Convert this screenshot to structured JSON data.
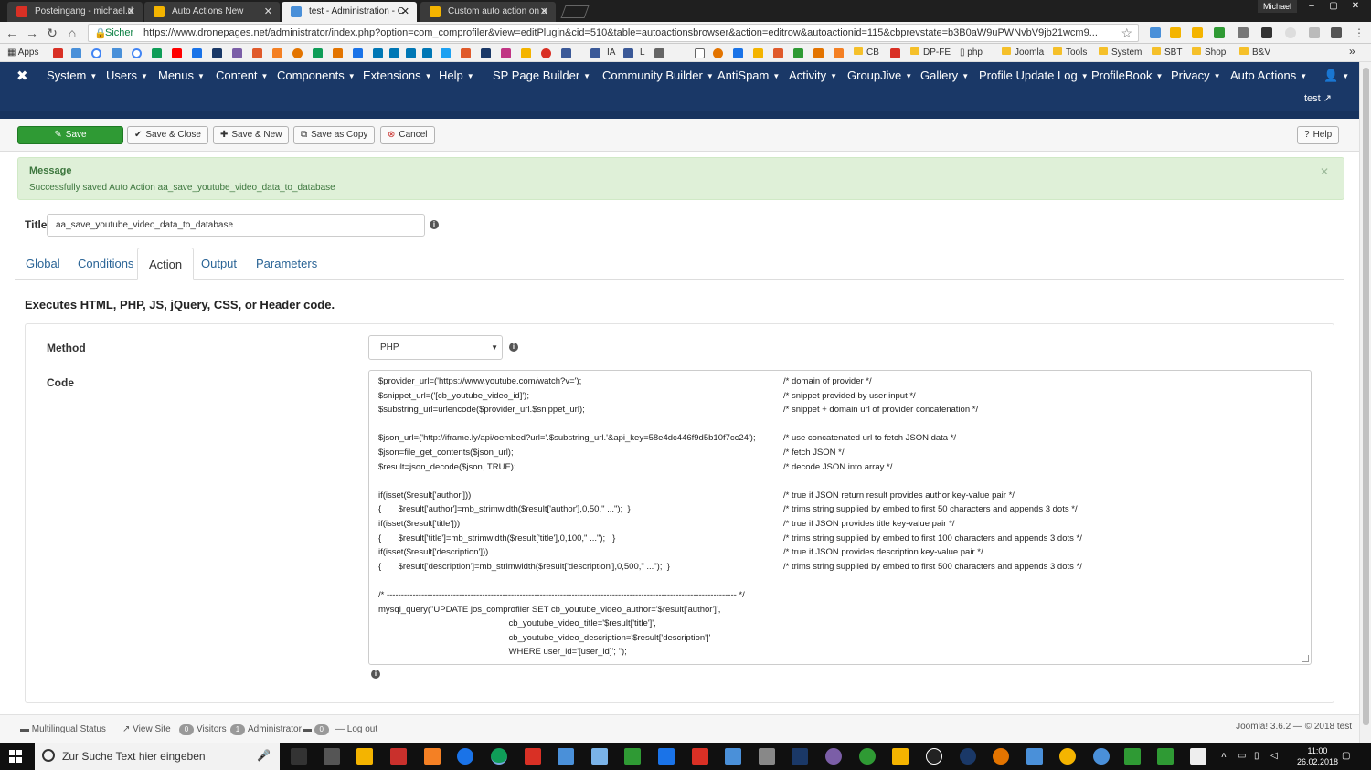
{
  "browser": {
    "tabs": [
      {
        "title": "Posteingang - michael.d",
        "favicon_color": "#d93025"
      },
      {
        "title": "Auto Actions New",
        "favicon_color": "#f4b400"
      },
      {
        "title": "test - Administration - C",
        "favicon_color": "#4a90d9"
      },
      {
        "title": "Custom auto action on a",
        "favicon_color": "#f4b400"
      }
    ],
    "profile": "Michael",
    "secure_label": "Sicher",
    "url": "https://www.dronepages.net/administrator/index.php?option=com_comprofiler&view=editPlugin&cid=510&table=autoactionsbrowser&action=editrow&autoactionid=115&cbprevstate=b3B0aW9uPWNvbV9jb21wcm9..."
  },
  "bookmarks": {
    "apps_label": "Apps",
    "items": [
      "IA",
      "L",
      "CB",
      "DP-FE",
      "php",
      "Joomla",
      "Tools",
      "System",
      "SBT",
      "Shop",
      "B&V"
    ]
  },
  "joomla_nav": {
    "items": [
      "System",
      "Users",
      "Menus",
      "Content",
      "Components",
      "Extensions",
      "Help",
      "SP Page Builder",
      "Community Builder",
      "AntiSpam",
      "Activity",
      "GroupJive",
      "Gallery",
      "Profile Update Log",
      "ProfileBook",
      "Privacy",
      "Auto Actions"
    ],
    "site_link": "test"
  },
  "toolbar": {
    "save": "Save",
    "save_close": "Save & Close",
    "save_new": "Save & New",
    "save_copy": "Save as Copy",
    "cancel": "Cancel",
    "help": "Help"
  },
  "message": {
    "title": "Message",
    "text": "Successfully saved Auto Action aa_save_youtube_video_data_to_database"
  },
  "form": {
    "title_label": "Title",
    "title_value": "aa_save_youtube_video_data_to_database",
    "tabs": [
      "Global",
      "Conditions",
      "Action",
      "Output",
      "Parameters"
    ],
    "active_tab": "Action",
    "description": "Executes HTML, PHP, JS, jQuery, CSS, or Header code.",
    "method_label": "Method",
    "method_value": "PHP",
    "code_label": "Code",
    "code_lines": [
      "$provider_url=('https://www.youtube.com/watch?v=');",
      "$snippet_url=('[cb_youtube_video_id]');",
      "$substring_url=urlencode($provider_url.$snippet_url);",
      "",
      "$json_url=('http://iframe.ly/api/oembed?url='.$substring_url.'&api_key=58e4dc446f9d5b10f7cc24');",
      "$json=file_get_contents($json_url);",
      "$result=json_decode($json, TRUE);",
      "",
      "if(isset($result['author']))",
      "{       $result['author']=mb_strimwidth($result['author'],0,50,\" ...\");  }",
      "if(isset($result['title']))",
      "{       $result['title']=mb_strimwidth($result['title'],0,100,\" ...\");   }",
      "if(isset($result['description']))",
      "{       $result['description']=mb_strimwidth($result['description'],0,500,\" ...\");  }",
      "",
      "/* ------------------------------------------------------------------------------------------------------------------------- */",
      "mysql_query(\"UPDATE jos_comprofiler SET cb_youtube_video_author='$result['author']',",
      "                                                      cb_youtube_video_title='$result['title']',",
      "                                                      cb_youtube_video_description='$result['description']'",
      "                                                      WHERE user_id='[user_id]'; \");"
    ],
    "code_comments": [
      "/* domain of provider */",
      "/* snippet provided by user input */",
      "/* snippet + domain url of provider concatenation */",
      "",
      "/* use concatenated url to fetch JSON data */",
      "/* fetch JSON */",
      "/* decode JSON into array */",
      "",
      "/* true if JSON return result provides author key-value pair */",
      "/* trims string supplied by embed to first 50 characters and appends 3 dots */",
      "/* true if JSON provides title key-value pair */",
      "/* trims string supplied by embed to first 100 characters and appends 3 dots */",
      "/* true if JSON provides description key-value pair */",
      "/* trims string supplied by embed to first 500 characters and appends 3 dots */",
      "",
      "",
      "",
      "",
      "",
      ""
    ]
  },
  "statusbar": {
    "multilingual": "Multilingual Status",
    "view_site": "View Site",
    "visitors_count": "0",
    "visitors": "Visitors",
    "admin_count": "1",
    "admin": "Administrator",
    "msg_count": "0",
    "logout": "Log out",
    "version": "Joomla! 3.6.2  —  © 2018 test"
  },
  "taskbar": {
    "search_placeholder": "Zur Suche Text hier eingeben",
    "time": "11:00",
    "date": "26.02.2018"
  }
}
